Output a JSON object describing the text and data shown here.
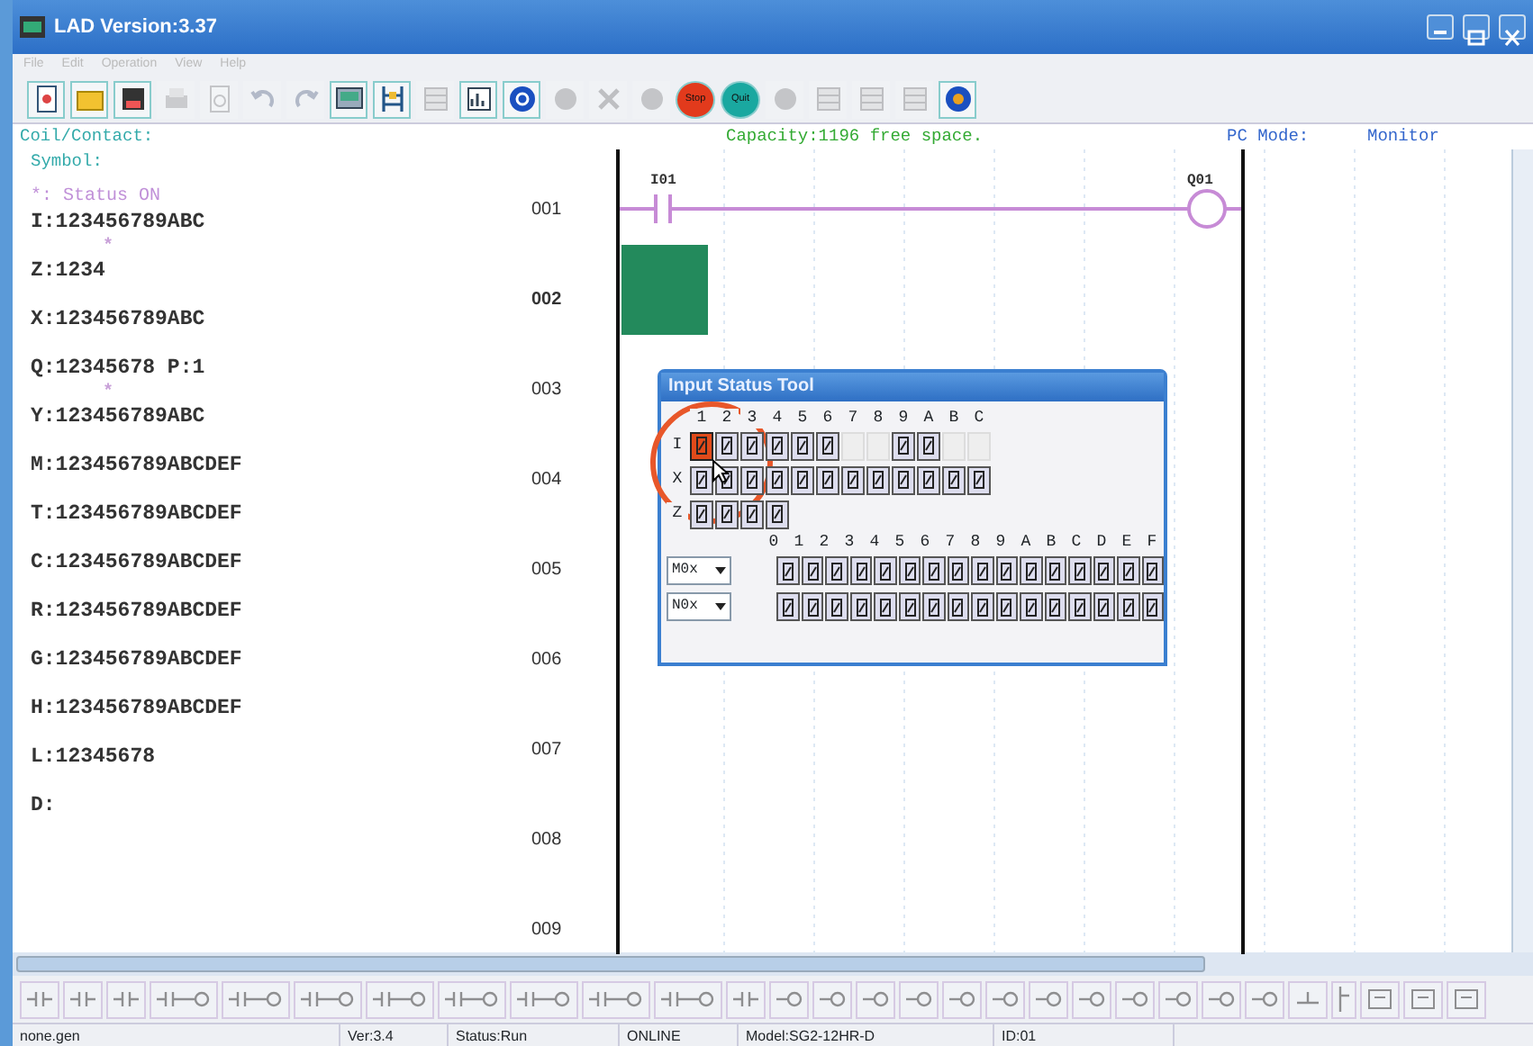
{
  "window": {
    "title": "LAD Version:3.37"
  },
  "menu": [
    {
      "label": "File",
      "disabled": true
    },
    {
      "label": "Edit",
      "disabled": true
    },
    {
      "label": "Operation",
      "disabled": true
    },
    {
      "label": "View",
      "disabled": true
    },
    {
      "label": "Help",
      "disabled": true
    }
  ],
  "toolbar": [
    {
      "kind": "doc",
      "disabled": false
    },
    {
      "kind": "folder",
      "disabled": false
    },
    {
      "kind": "save",
      "disabled": false
    },
    {
      "kind": "print",
      "disabled": true
    },
    {
      "kind": "preview",
      "disabled": true
    },
    {
      "kind": "undo",
      "disabled": true
    },
    {
      "kind": "redo",
      "disabled": true
    },
    {
      "kind": "screen",
      "disabled": false
    },
    {
      "kind": "ladder",
      "disabled": false
    },
    {
      "kind": "table",
      "disabled": true
    },
    {
      "kind": "chart",
      "disabled": false
    },
    {
      "kind": "link",
      "disabled": false
    },
    {
      "kind": "circle",
      "disabled": true
    },
    {
      "kind": "tools",
      "disabled": true
    },
    {
      "kind": "circle",
      "disabled": true
    },
    {
      "kind": "stop",
      "label": "Stop",
      "disabled": false
    },
    {
      "kind": "quit",
      "label": "Quit",
      "disabled": false
    },
    {
      "kind": "circle",
      "disabled": true
    },
    {
      "kind": "table",
      "disabled": true
    },
    {
      "kind": "table",
      "disabled": true
    },
    {
      "kind": "table",
      "disabled": true
    },
    {
      "kind": "help",
      "disabled": false
    }
  ],
  "info_bar": {
    "coil_contact": "Coil/Contact:",
    "capacity": "Capacity:1196 free space.",
    "pc_mode_label": "PC Mode:",
    "pc_mode": "Monitor"
  },
  "symbol_panel": {
    "title": "Symbol:",
    "items": [
      {
        "kind": "legend",
        "text": "*: Status ON"
      },
      {
        "kind": "status",
        "text": "I:123456789ABC",
        "marker": "*"
      },
      {
        "kind": "status",
        "text": "Z:1234"
      },
      {
        "kind": "status",
        "text": "X:123456789ABC"
      },
      {
        "kind": "status",
        "text": "Q:12345678 P:1",
        "marker": "*"
      },
      {
        "kind": "status",
        "text": "Y:123456789ABC"
      },
      {
        "kind": "status",
        "text": "M:123456789ABCDEF"
      },
      {
        "kind": "status",
        "text": "T:123456789ABCDEF"
      },
      {
        "kind": "status",
        "text": "C:123456789ABCDEF"
      },
      {
        "kind": "status",
        "text": "R:123456789ABCDEF"
      },
      {
        "kind": "status",
        "text": "G:123456789ABCDEF"
      },
      {
        "kind": "status",
        "text": "H:123456789ABCDEF"
      },
      {
        "kind": "status",
        "text": "L:12345678"
      },
      {
        "kind": "status",
        "text": "D:"
      }
    ]
  },
  "ladder": {
    "rungs": [
      {
        "number": "001",
        "selected": false,
        "elements": [
          {
            "kind": "contact",
            "label": "I01"
          },
          {
            "kind": "coil",
            "label": "Q01"
          }
        ]
      },
      {
        "number": "002",
        "selected": true
      },
      {
        "number": "003",
        "selected": false
      },
      {
        "number": "004",
        "selected": false
      },
      {
        "number": "005",
        "selected": false
      },
      {
        "number": "006",
        "selected": false
      },
      {
        "number": "007",
        "selected": false
      },
      {
        "number": "008",
        "selected": false
      },
      {
        "number": "009",
        "selected": false
      }
    ]
  },
  "input_status_tool": {
    "title": "Input Status Tool",
    "columns": [
      "1",
      "2",
      "3",
      "4",
      "5",
      "6",
      "7",
      "8",
      "9",
      "A",
      "B",
      "C"
    ],
    "rows": [
      {
        "label": "I",
        "cells": [
          {
            "on": true,
            "disabled": false
          },
          {
            "on": false,
            "disabled": false
          },
          {
            "on": false,
            "disabled": false
          },
          {
            "on": false,
            "disabled": false
          },
          {
            "on": false,
            "disabled": false
          },
          {
            "on": false,
            "disabled": false
          },
          {
            "on": false,
            "disabled": true
          },
          {
            "on": false,
            "disabled": true
          },
          {
            "on": false,
            "disabled": false
          },
          {
            "on": false,
            "disabled": false
          },
          {
            "on": false,
            "disabled": true
          },
          {
            "on": false,
            "disabled": true
          }
        ]
      },
      {
        "label": "X",
        "cells": [
          {
            "on": false,
            "disabled": false
          },
          {
            "on": false,
            "disabled": false
          },
          {
            "on": false,
            "disabled": false
          },
          {
            "on": false,
            "disabled": false
          },
          {
            "on": false,
            "disabled": false
          },
          {
            "on": false,
            "disabled": false
          },
          {
            "on": false,
            "disabled": false
          },
          {
            "on": false,
            "disabled": false
          },
          {
            "on": false,
            "disabled": false
          },
          {
            "on": false,
            "disabled": false
          },
          {
            "on": false,
            "disabled": false
          },
          {
            "on": false,
            "disabled": false
          }
        ]
      },
      {
        "label": "Z",
        "cells": [
          {
            "on": false,
            "disabled": false
          },
          {
            "on": false,
            "disabled": false
          },
          {
            "on": false,
            "disabled": false
          },
          {
            "on": false,
            "disabled": false
          }
        ]
      }
    ],
    "bank_columns": [
      "0",
      "1",
      "2",
      "3",
      "4",
      "5",
      "6",
      "7",
      "8",
      "9",
      "A",
      "B",
      "C",
      "D",
      "E",
      "F"
    ],
    "banks": [
      {
        "select": "M0x"
      },
      {
        "select": "N0x"
      }
    ]
  },
  "bottom_toolbar": [
    {
      "kind": "contact"
    },
    {
      "kind": "contact"
    },
    {
      "kind": "contact"
    },
    {
      "kind": "contact-coil"
    },
    {
      "kind": "contact-coil"
    },
    {
      "kind": "contact-coil"
    },
    {
      "kind": "contact-coil"
    },
    {
      "kind": "contact-coil"
    },
    {
      "kind": "contact-coil"
    },
    {
      "kind": "contact-coil"
    },
    {
      "kind": "contact-coil"
    },
    {
      "kind": "contact"
    },
    {
      "kind": "coil"
    },
    {
      "kind": "coil"
    },
    {
      "kind": "coil"
    },
    {
      "kind": "coil"
    },
    {
      "kind": "coil"
    },
    {
      "kind": "coil"
    },
    {
      "kind": "coil"
    },
    {
      "kind": "coil"
    },
    {
      "kind": "coil"
    },
    {
      "kind": "coil"
    },
    {
      "kind": "coil"
    },
    {
      "kind": "coil"
    },
    {
      "kind": "line"
    },
    {
      "kind": "vline"
    },
    {
      "kind": "edit"
    },
    {
      "kind": "edit"
    },
    {
      "kind": "edit"
    }
  ],
  "status_bar": [
    "none.gen",
    "Ver:3.4",
    "Status:Run",
    "ONLINE",
    "Model:SG2-12HR-D",
    "ID:01"
  ]
}
